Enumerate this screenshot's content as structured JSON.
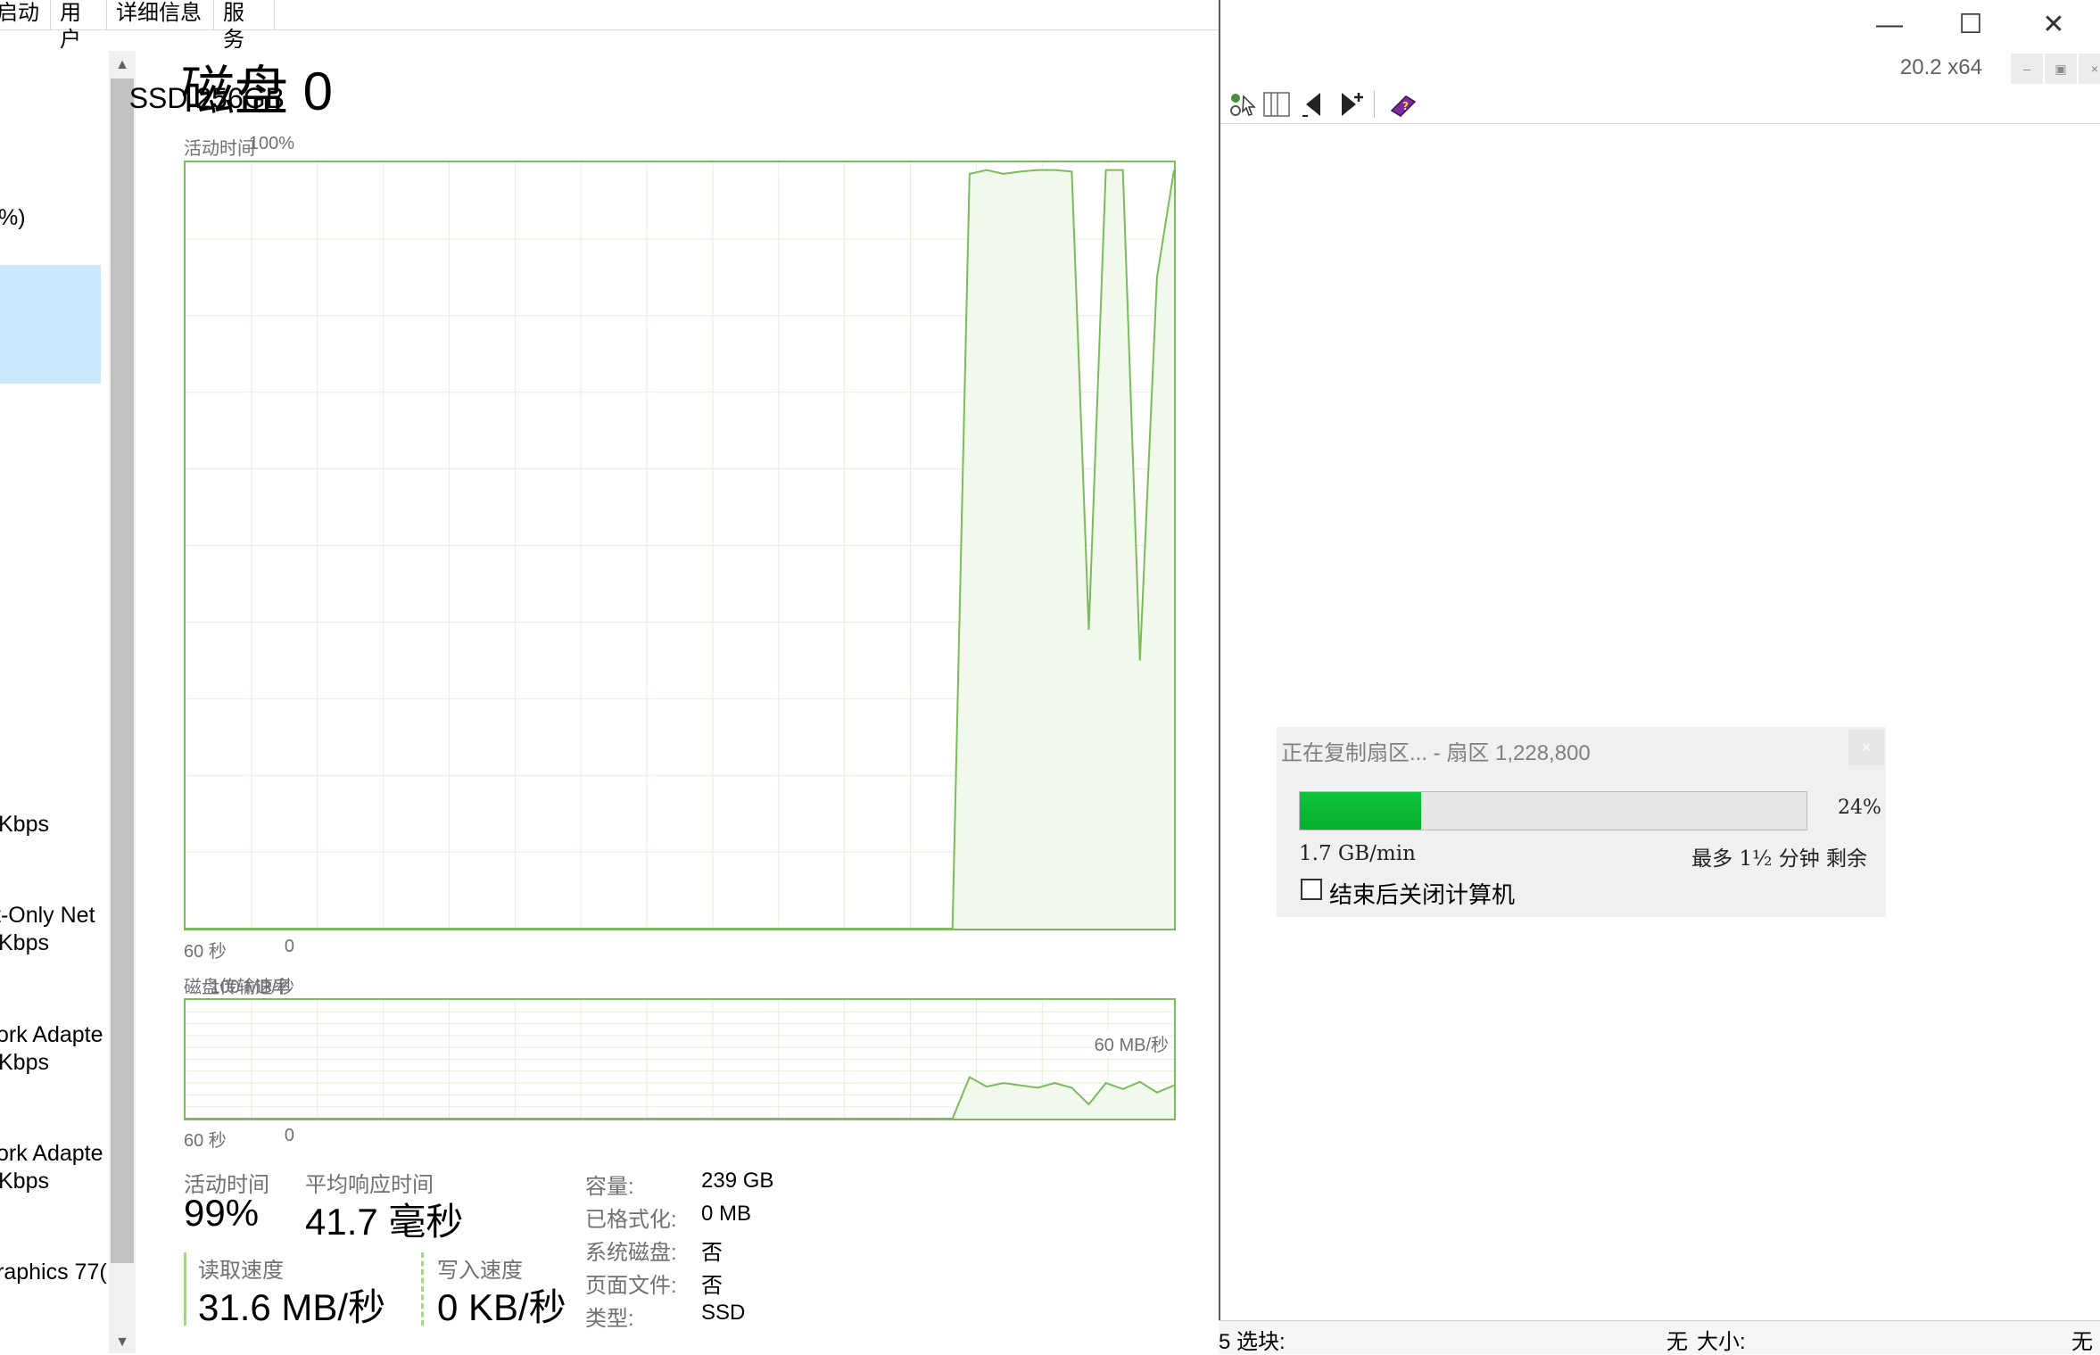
{
  "tabs": [
    "启动",
    "用户",
    "详细信息",
    "服务"
  ],
  "sidebar": {
    "items": [
      "%)",
      "Kbps",
      "t-Only Net",
      "Kbps",
      "ork Adapte",
      "Kbps",
      "ork Adapte",
      "Kbps",
      "raphics 77("
    ]
  },
  "disk": {
    "title": "磁盘 0",
    "model": "SSD 256GB",
    "active_time_label": "活动时间",
    "active_time_max": "100%",
    "time_left": "60 秒",
    "time_right": "0",
    "transfer_label": "磁盘传输速率",
    "transfer_max": "100 MB/秒",
    "transfer_mark": "60 MB/秒",
    "time_left2": "60 秒",
    "time_right2": "0",
    "activity_series": [
      0,
      0,
      0,
      0,
      0,
      0,
      0,
      0,
      0,
      0,
      0,
      0,
      0,
      0,
      0,
      0,
      0,
      0,
      0,
      0,
      0,
      0,
      0,
      0,
      0,
      0,
      0,
      0,
      0,
      0,
      0,
      0,
      0,
      0,
      0,
      0,
      0,
      0,
      0,
      0,
      0,
      0,
      0,
      0,
      0,
      0,
      98.5,
      99,
      98.5,
      98.8,
      99,
      99,
      98.8,
      39,
      99,
      99,
      35,
      85,
      99
    ],
    "transfer_series": [
      0,
      0,
      0,
      0,
      0,
      0,
      0,
      0,
      0,
      0,
      0,
      0,
      0,
      0,
      0,
      0,
      0,
      0,
      0,
      0,
      0,
      0,
      0,
      0,
      0,
      0,
      0,
      0,
      0,
      0,
      0,
      0,
      0,
      0,
      0,
      0,
      0,
      0,
      0,
      0,
      0,
      0,
      0,
      0,
      0,
      0,
      35,
      27,
      30,
      28,
      26,
      30,
      26,
      12,
      30,
      25,
      31,
      22,
      28
    ]
  },
  "stats": {
    "active_label": "活动时间",
    "active_value": "99%",
    "response_label": "平均响应时间",
    "response_value": "41.7 毫秒",
    "read_label": "读取速度",
    "read_value": "31.6 MB/秒",
    "write_label": "写入速度",
    "write_value": "0 KB/秒"
  },
  "props": [
    {
      "key": "容量:",
      "value": "239 GB"
    },
    {
      "key": "已格式化:",
      "value": "0 MB"
    },
    {
      "key": "系统磁盘:",
      "value": "否"
    },
    {
      "key": "页面文件:",
      "value": "否"
    },
    {
      "key": "类型:",
      "value": "SSD"
    }
  ],
  "rightwin": {
    "version": "20.2 x64",
    "progress": {
      "title": "正在复制扇区... - 扇区 1,228,800",
      "percent": 24,
      "percent_label": "24%",
      "speed": "1.7 GB/min",
      "remaining": "最多 1½ 分钟 剩余",
      "shutdown_label": "结束后关闭计算机"
    },
    "status": {
      "left": "5 选块:",
      "mid": "无",
      "size_label": "大小:",
      "right": "无"
    }
  },
  "colors": {
    "graph_line": "#7cbb5a",
    "graph_fill": "#f1f8ec",
    "progress_green": "#06b02c"
  }
}
